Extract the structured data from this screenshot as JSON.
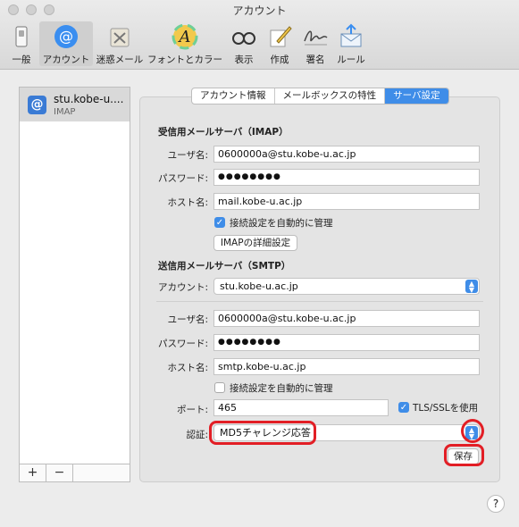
{
  "window": {
    "title": "アカウント"
  },
  "toolbar": {
    "items": [
      {
        "label": "一般",
        "icon": "general-switch-icon"
      },
      {
        "label": "アカウント",
        "icon": "at-sign-icon"
      },
      {
        "label": "迷惑メール",
        "icon": "junk-trash-icon"
      },
      {
        "label": "フォントとカラー",
        "icon": "font-color-icon"
      },
      {
        "label": "表示",
        "icon": "glasses-icon"
      },
      {
        "label": "作成",
        "icon": "pencil-icon"
      },
      {
        "label": "署名",
        "icon": "signature-icon"
      },
      {
        "label": "ルール",
        "icon": "rules-envelope-icon"
      }
    ]
  },
  "sidebar": {
    "account": {
      "name": "stu.kobe-u....",
      "type": "IMAP"
    },
    "add_label": "+",
    "remove_label": "−"
  },
  "tabs": [
    "アカウント情報",
    "メールボックスの特性",
    "サーバ設定"
  ],
  "imap": {
    "title": "受信用メールサーバ（IMAP）",
    "user_label": "ユーザ名:",
    "user_value": "0600000a@stu.kobe-u.ac.jp",
    "password_label": "パスワード:",
    "password_value": "●●●●●●●●",
    "host_label": "ホスト名:",
    "host_value": "mail.kobe-u.ac.jp",
    "auto_label": "接続設定を自動的に管理",
    "auto_checked": true,
    "details_button": "IMAPの詳細設定"
  },
  "smtp": {
    "title": "送信用メールサーバ（SMTP）",
    "account_label": "アカウント:",
    "account_value": "stu.kobe-u.ac.jp",
    "user_label": "ユーザ名:",
    "user_value": "0600000a@stu.kobe-u.ac.jp",
    "password_label": "パスワード:",
    "password_value": "●●●●●●●●",
    "host_label": "ホスト名:",
    "host_value": "smtp.kobe-u.ac.jp",
    "auto_label": "接続設定を自動的に管理",
    "auto_checked": false,
    "port_label": "ポート:",
    "port_value": "465",
    "tls_label": "TLS/SSLを使用",
    "tls_checked": true,
    "auth_label": "認証:",
    "auth_value": "MD5チャレンジ応答",
    "save_button": "保存"
  },
  "help_label": "?",
  "colors": {
    "accent": "#3f8de8",
    "highlight": "#e21e25"
  }
}
